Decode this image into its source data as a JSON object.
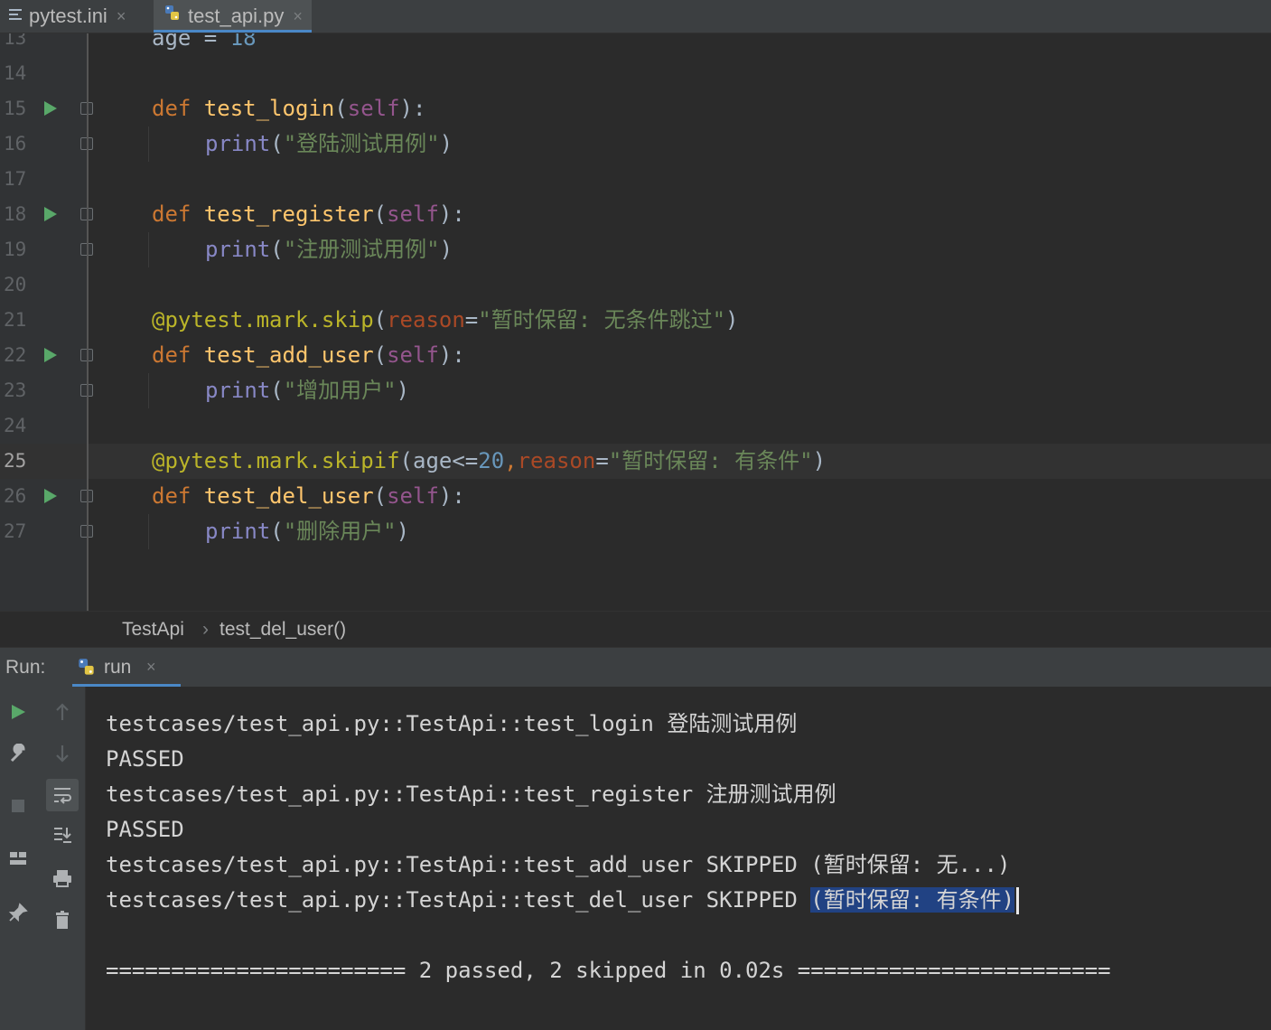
{
  "tabs": [
    {
      "label": "pytest.ini",
      "icon": "ini-file-icon"
    },
    {
      "label": "test_api.py",
      "icon": "python-file-icon",
      "active": true
    }
  ],
  "editor": {
    "current_line": 25,
    "lines": [
      {
        "n": "13",
        "text": "age = 18"
      },
      {
        "n": "14",
        "text": ""
      },
      {
        "n": "15",
        "text": "def test_login(self):"
      },
      {
        "n": "16",
        "text": "print(\"登陆测试用例\")"
      },
      {
        "n": "17",
        "text": ""
      },
      {
        "n": "18",
        "text": "def test_register(self):"
      },
      {
        "n": "19",
        "text": "print(\"注册测试用例\")"
      },
      {
        "n": "20",
        "text": ""
      },
      {
        "n": "21",
        "text": "@pytest.mark.skip(reason=\"暂时保留: 无条件跳过\")"
      },
      {
        "n": "22",
        "text": "def test_add_user(self):"
      },
      {
        "n": "23",
        "text": "print(\"增加用户\")"
      },
      {
        "n": "24",
        "text": ""
      },
      {
        "n": "25",
        "text": "@pytest.mark.skipif(age<=20,reason=\"暂时保留: 有条件\")"
      },
      {
        "n": "26",
        "text": "def test_del_user(self):"
      },
      {
        "n": "27",
        "text": "print(\"删除用户\")"
      }
    ],
    "tokens": {
      "l13_a": "age = ",
      "l13_b": "18",
      "def": "def ",
      "self": "self",
      "print": "print",
      "l15_fn": "test_login",
      "l16_str": "\"登陆测试用例\"",
      "l18_fn": "test_register",
      "l19_str": "\"注册测试用例\"",
      "l21_deco": "@pytest.mark.skip",
      "reason": "reason",
      "l21_str": "\"暂时保留: 无条件跳过\"",
      "l22_fn": "test_add_user",
      "l23_str": "\"增加用户\"",
      "l25_deco": "@pytest.mark.skipif",
      "l25_arg": "age<=",
      "l25_num": "20",
      "l25_str": "\"暂时保留: 有条件\"",
      "l26_fn": "test_del_user",
      "l27_str": "\"删除用户\""
    }
  },
  "breadcrumb": {
    "class_name": "TestApi",
    "separator": "›",
    "method_name": "test_del_user()"
  },
  "run_panel": {
    "label": "Run:",
    "tab_label": "run",
    "close": "×"
  },
  "console": {
    "lines": [
      "testcases/test_api.py::TestApi::test_login 登陆测试用例",
      "PASSED",
      "testcases/test_api.py::TestApi::test_register 注册测试用例",
      "PASSED",
      "testcases/test_api.py::TestApi::test_add_user SKIPPED (暂时保留: 无...)",
      "testcases/test_api.py::TestApi::test_del_user SKIPPED ",
      "",
      "======================= 2 passed, 2 skipped in 0.02s ========================"
    ],
    "selected_text": "(暂时保留: 有条件)"
  },
  "colors": {
    "keyword": "#cc7832",
    "function": "#ffc66d",
    "string": "#6a8759",
    "decorator": "#bbb529",
    "self": "#94558d",
    "number": "#6897bb",
    "run_icon": "#59a869",
    "selection": "#214283"
  }
}
